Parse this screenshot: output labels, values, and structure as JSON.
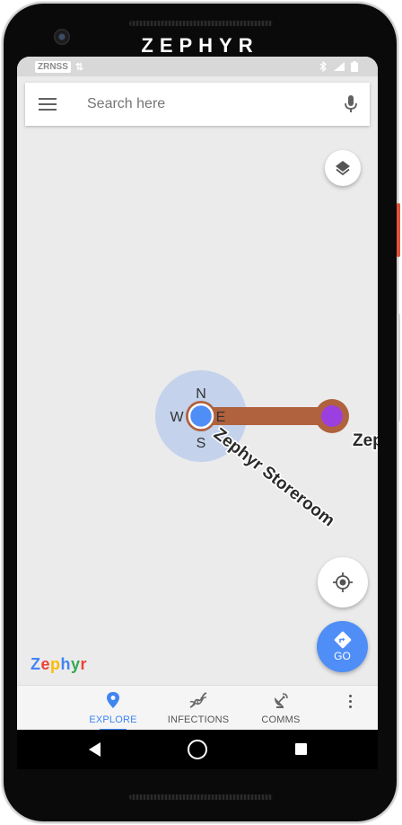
{
  "device": {
    "brand": "ZEPHYR"
  },
  "status_bar": {
    "carrier": "ZRNSS",
    "data_icon": "data-arrows-icon",
    "icons": [
      "bluetooth-icon",
      "signal-icon",
      "battery-icon"
    ]
  },
  "search": {
    "placeholder": "Search here"
  },
  "map": {
    "compass": {
      "n": "N",
      "e": "E",
      "s": "S",
      "w": "W"
    },
    "place_label": "Zephyr Storeroom",
    "place_label_partial": "Zep",
    "colors": {
      "route": "#b0613e",
      "destination": "#9b3fe0",
      "location": "#4f8ef7",
      "accuracy_halo": "#b7c9ec"
    }
  },
  "buttons": {
    "go_label": "GO"
  },
  "logo": {
    "letters": [
      "Z",
      "e",
      "p",
      "h",
      "y",
      "r"
    ],
    "colors": [
      "#4285f4",
      "#ea4335",
      "#fbbc05",
      "#4285f4",
      "#34a853",
      "#ea4335"
    ]
  },
  "bottom_nav": {
    "items": [
      {
        "label": "EXPLORE",
        "icon": "map-pin-icon",
        "active": true
      },
      {
        "label": "INFECTIONS",
        "icon": "dna-icon",
        "active": false
      },
      {
        "label": "COMMS",
        "icon": "satellite-dish-icon",
        "active": false
      }
    ]
  },
  "accent_color": "#3f85f2"
}
